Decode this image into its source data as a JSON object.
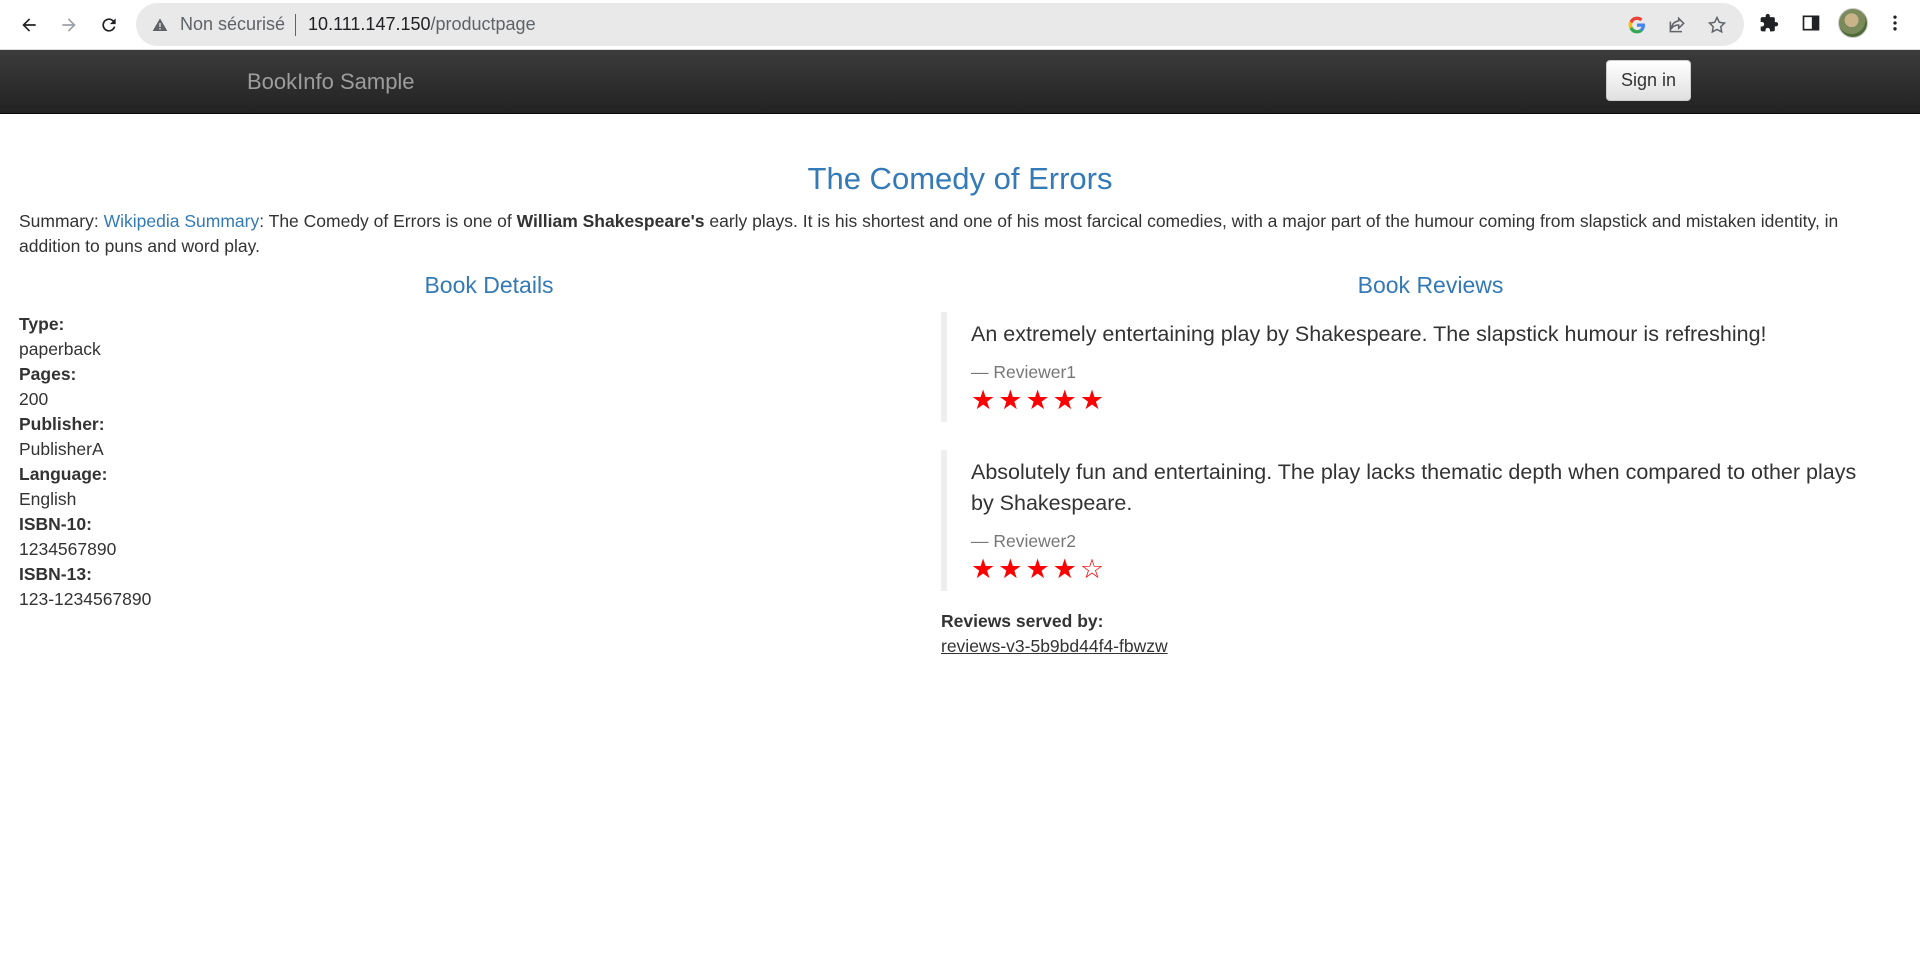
{
  "browser": {
    "security_label": "Non sécurisé",
    "url_host": "10.111.147.150",
    "url_path": "/productpage"
  },
  "navbar": {
    "brand": "BookInfo Sample",
    "signin_label": "Sign in"
  },
  "book": {
    "title": "The Comedy of Errors",
    "summary_prefix": "Summary: ",
    "summary_link": "Wikipedia Summary",
    "summary_text_1": ": The Comedy of Errors is one of ",
    "summary_bold": "William Shakespeare's",
    "summary_text_2": " early plays. It is his shortest and one of his most farcical comedies, with a major part of the humour coming from slapstick and mistaken identity, in addition to puns and word play."
  },
  "details": {
    "title": "Book Details",
    "fields": [
      {
        "label": "Type:",
        "value": "paperback"
      },
      {
        "label": "Pages:",
        "value": "200"
      },
      {
        "label": "Publisher:",
        "value": "PublisherA"
      },
      {
        "label": "Language:",
        "value": "English"
      },
      {
        "label": "ISBN-10:",
        "value": "1234567890"
      },
      {
        "label": "ISBN-13:",
        "value": "123-1234567890"
      }
    ]
  },
  "reviews": {
    "title": "Book Reviews",
    "items": [
      {
        "text": "An extremely entertaining play by Shakespeare. The slapstick humour is refreshing!",
        "reviewer": "— Reviewer1",
        "rating": 5,
        "max": 5,
        "star_color": "#ff0000"
      },
      {
        "text": "Absolutely fun and entertaining. The play lacks thematic depth when compared to other plays by Shakespeare.",
        "reviewer": "— Reviewer2",
        "rating": 4,
        "max": 5,
        "star_color": "#ff0000"
      }
    ],
    "served_by_label": "Reviews served by:",
    "served_by_value": "reviews-v3-5b9bd44f4-fbwzw"
  },
  "colors": {
    "link": "#337ab7",
    "navbar_bg": "#222222",
    "star": "#ff0000"
  }
}
